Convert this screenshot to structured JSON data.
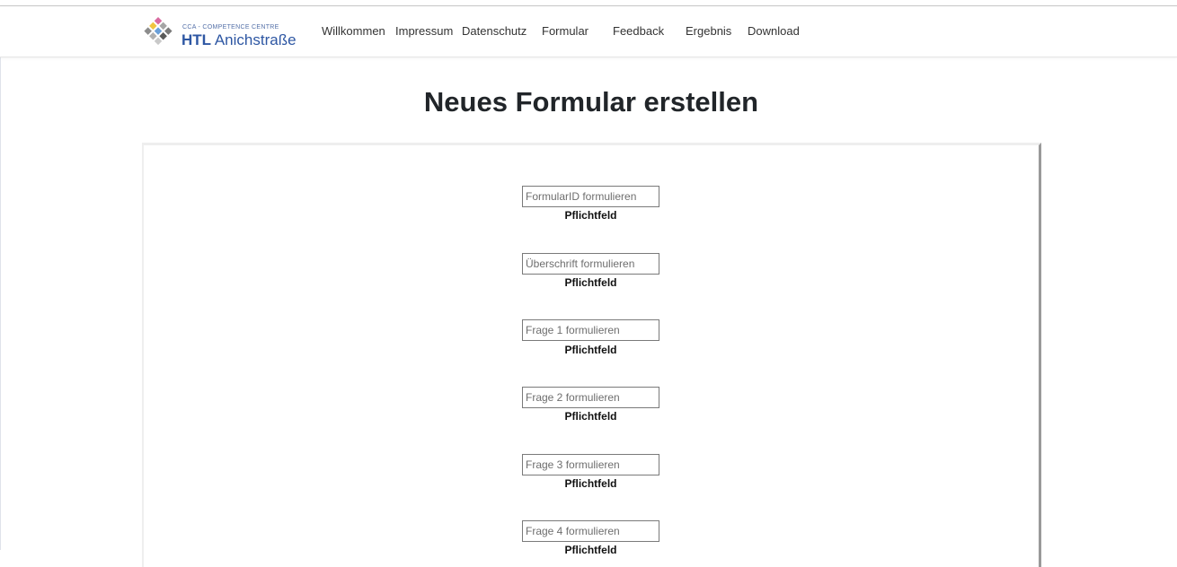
{
  "brand": {
    "small_text": "CCA - COMPETENCE CENTRE",
    "name_bold": "HTL",
    "name_regular": "Anichstraße",
    "logo_colors": [
      "#d96aa0",
      "#a5a5a5",
      "#7a7a7a",
      "#f0c540",
      "#6a9fd8",
      "#5a5a5a",
      "#8c8c8c",
      "#b0b0b0",
      "#c9c9c9"
    ]
  },
  "nav": {
    "items": [
      {
        "label": "Willkommen"
      },
      {
        "label": "Impressum"
      },
      {
        "label": "Datenschutz"
      },
      {
        "label": "Formular"
      },
      {
        "label": "Feedback"
      },
      {
        "label": "Ergebnis"
      },
      {
        "label": "Download"
      }
    ]
  },
  "page": {
    "title": "Neues Formular erstellen"
  },
  "form": {
    "required_label": "Pflichtfeld",
    "fields": [
      {
        "placeholder": "FormularID formulieren",
        "value": ""
      },
      {
        "placeholder": "Überschrift formulieren",
        "value": ""
      },
      {
        "placeholder": "Frage 1 formulieren",
        "value": ""
      },
      {
        "placeholder": "Frage 2 formulieren",
        "value": ""
      },
      {
        "placeholder": "Frage 3 formulieren",
        "value": ""
      },
      {
        "placeholder": "Frage 4 formulieren",
        "value": ""
      }
    ]
  }
}
